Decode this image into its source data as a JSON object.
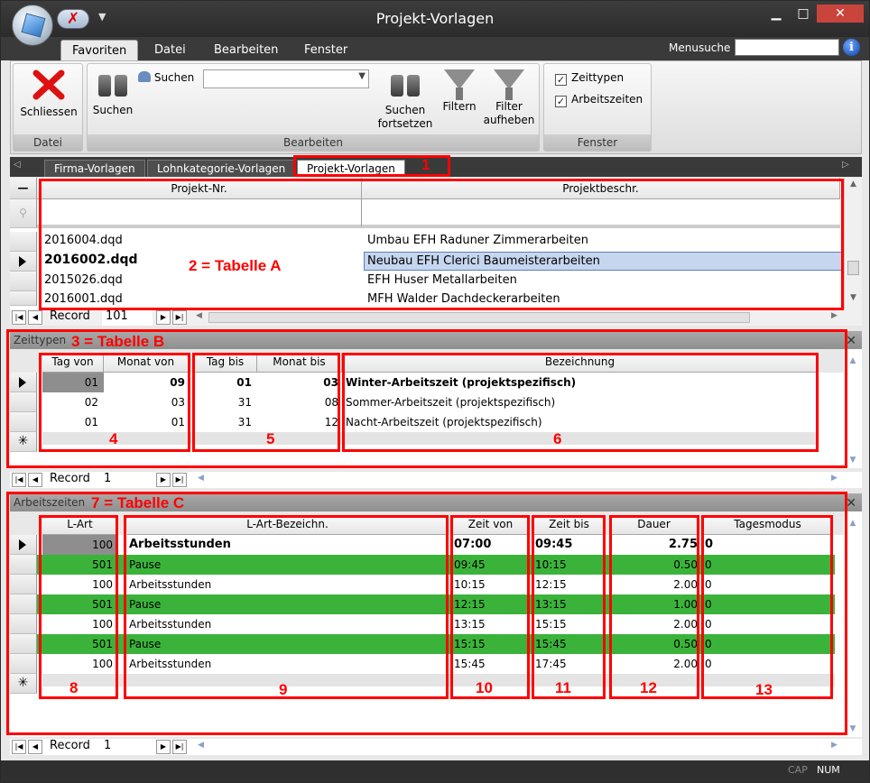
{
  "window": {
    "title": "Projekt-Vorlagen"
  },
  "menu": {
    "tabs": [
      "Favoriten",
      "Datei",
      "Bearbeiten",
      "Fenster"
    ],
    "search_label": "Menusuche"
  },
  "ribbon": {
    "groups": {
      "datei": "Datei",
      "bearbeiten": "Bearbeiten",
      "fenster": "Fenster"
    },
    "buttons": {
      "schliessen": "Schliessen",
      "suchen": "Suchen",
      "suchen_small": "Suchen",
      "suchen_fortsetzen_1": "Suchen",
      "suchen_fortsetzen_2": "fortsetzen",
      "filtern": "Filtern",
      "filter_aufheben_1": "Filter",
      "filter_aufheben_2": "aufheben"
    },
    "checkboxes": [
      "Zeittypen",
      "Arbeitszeiten"
    ]
  },
  "doc_tabs": [
    "Firma-Vorlagen",
    "Lohnkategorie-Vorlagen",
    "Projekt-Vorlagen"
  ],
  "table_a": {
    "headers": [
      "Projekt-Nr.",
      "Projektbeschr."
    ],
    "rows": [
      [
        "2016004.dqd",
        "Umbau EFH Raduner Zimmerarbeiten"
      ],
      [
        "2016002.dqd",
        "Neubau EFH Clerici Baumeisterarbeiten"
      ],
      [
        "2015026.dqd",
        "EFH Huser Metallarbeiten"
      ],
      [
        "2016001.dqd",
        "MFH Walder Dachdeckerarbeiten"
      ]
    ],
    "nav_label": "Record",
    "nav_value": "101"
  },
  "table_b": {
    "title": "Zeittypen",
    "headers": [
      "Tag von",
      "Monat von",
      "Tag bis",
      "Monat bis",
      "Bezeichnung"
    ],
    "rows": [
      [
        "01",
        "09",
        "01",
        "03",
        "Winter-Arbeitszeit (projektspezifisch)"
      ],
      [
        "02",
        "03",
        "31",
        "08",
        "Sommer-Arbeitszeit (projektspezifisch)"
      ],
      [
        "01",
        "01",
        "31",
        "12",
        "Nacht-Arbeitszeit (projektspezifisch)"
      ]
    ],
    "nav_label": "Record",
    "nav_value": "1"
  },
  "table_c": {
    "title": "Arbeitszeiten",
    "headers": [
      "L-Art",
      "L-Art-Bezeichn.",
      "Zeit von",
      "Zeit bis",
      "Dauer",
      "Tagesmodus"
    ],
    "rows": [
      [
        "100",
        "Arbeitsstunden",
        "07:00",
        "09:45",
        "2.75",
        "0"
      ],
      [
        "501",
        "Pause",
        "09:45",
        "10:15",
        "0.50",
        "0"
      ],
      [
        "100",
        "Arbeitsstunden",
        "10:15",
        "12:15",
        "2.00",
        "0"
      ],
      [
        "501",
        "Pause",
        "12:15",
        "13:15",
        "1.00",
        "0"
      ],
      [
        "100",
        "Arbeitsstunden",
        "13:15",
        "15:15",
        "2.00",
        "0"
      ],
      [
        "501",
        "Pause",
        "15:15",
        "15:45",
        "0.50",
        "0"
      ],
      [
        "100",
        "Arbeitsstunden",
        "15:45",
        "17:45",
        "2.00",
        "0"
      ]
    ],
    "nav_label": "Record",
    "nav_value": "1"
  },
  "annotations": {
    "a1": "1",
    "a2": "2 = Tabelle A",
    "a3": "3 = Tabelle B",
    "a4": "4",
    "a5": "5",
    "a6": "6",
    "a7": "7 = Tabelle C",
    "a8": "8",
    "a9": "9",
    "a10": "10",
    "a11": "11",
    "a12": "12",
    "a13": "13"
  },
  "status": {
    "cap": "CAP",
    "num": "NUM"
  },
  "colors": {
    "pause_row": "#3bb33b",
    "annotation": "#ff0000"
  }
}
